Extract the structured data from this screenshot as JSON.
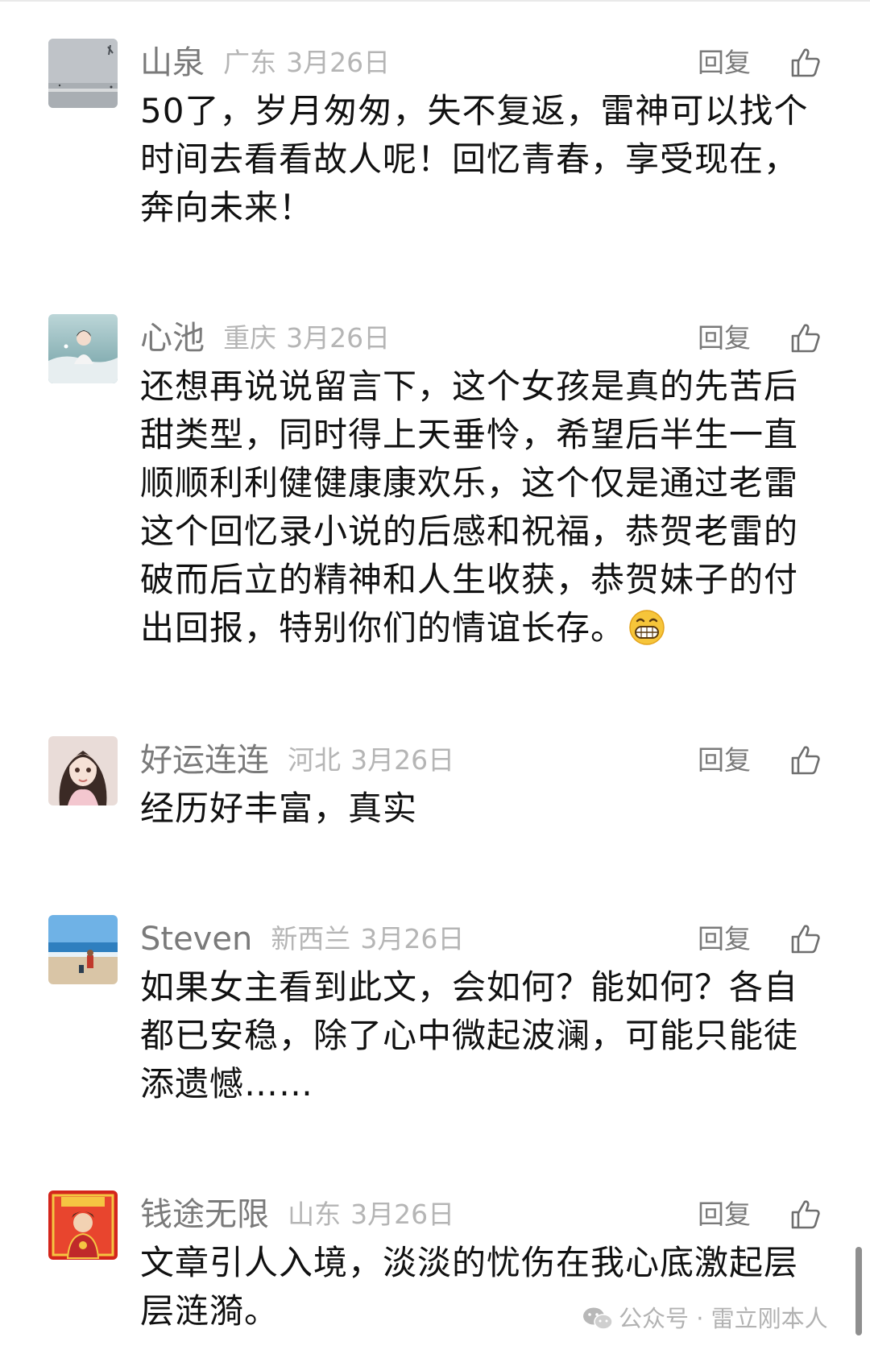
{
  "comments": [
    {
      "nickname": "山泉",
      "region": "广东",
      "date": "3月26日",
      "reply_label": "回复",
      "lines": [
        "50了，岁月匆匆，失不复返，雷神可以找个",
        "时间去看看故人呢！回忆青春，享受现在，",
        "奔向未来！"
      ]
    },
    {
      "nickname": "心池",
      "region": "重庆",
      "date": "3月26日",
      "reply_label": "回复",
      "lines": [
        "还想再说说留言下，这个女孩是真的先苦后",
        "甜类型，同时得上天垂怜，希望后半生一直",
        "顺顺利利健健康康欢乐，这个仅是通过老雷",
        "这个回忆录小说的后感和祝福，恭贺老雷的",
        "破而后立的精神和人生收获，恭贺妹子的付",
        "出回报，特别你们的情谊长存。"
      ]
    },
    {
      "nickname": "好运连连",
      "region": "河北",
      "date": "3月26日",
      "reply_label": "回复",
      "lines": [
        "经历好丰富，真实"
      ]
    },
    {
      "nickname": "Steven",
      "region": "新西兰",
      "date": "3月26日",
      "reply_label": "回复",
      "lines": [
        "如果女主看到此文，会如何？能如何？各自",
        "都已安稳，除了心中微起波澜，可能只能徒",
        "添遗憾……"
      ]
    },
    {
      "nickname": "钱途无限",
      "region": "山东",
      "date": "3月26日",
      "reply_label": "回复",
      "lines": [
        "文章引人入境，淡淡的忧伤在我心底激起层",
        "层涟漪。"
      ]
    }
  ],
  "watermark": {
    "label": "公众号 · 雷立刚本人"
  },
  "icons": {
    "like": "thumbs-up-icon",
    "emoji": "grinning-face-icon",
    "watermark": "wechat-icon"
  },
  "colors": {
    "nickname": "#7a7a7a",
    "meta": "#b5b5b5",
    "text": "#111111"
  }
}
